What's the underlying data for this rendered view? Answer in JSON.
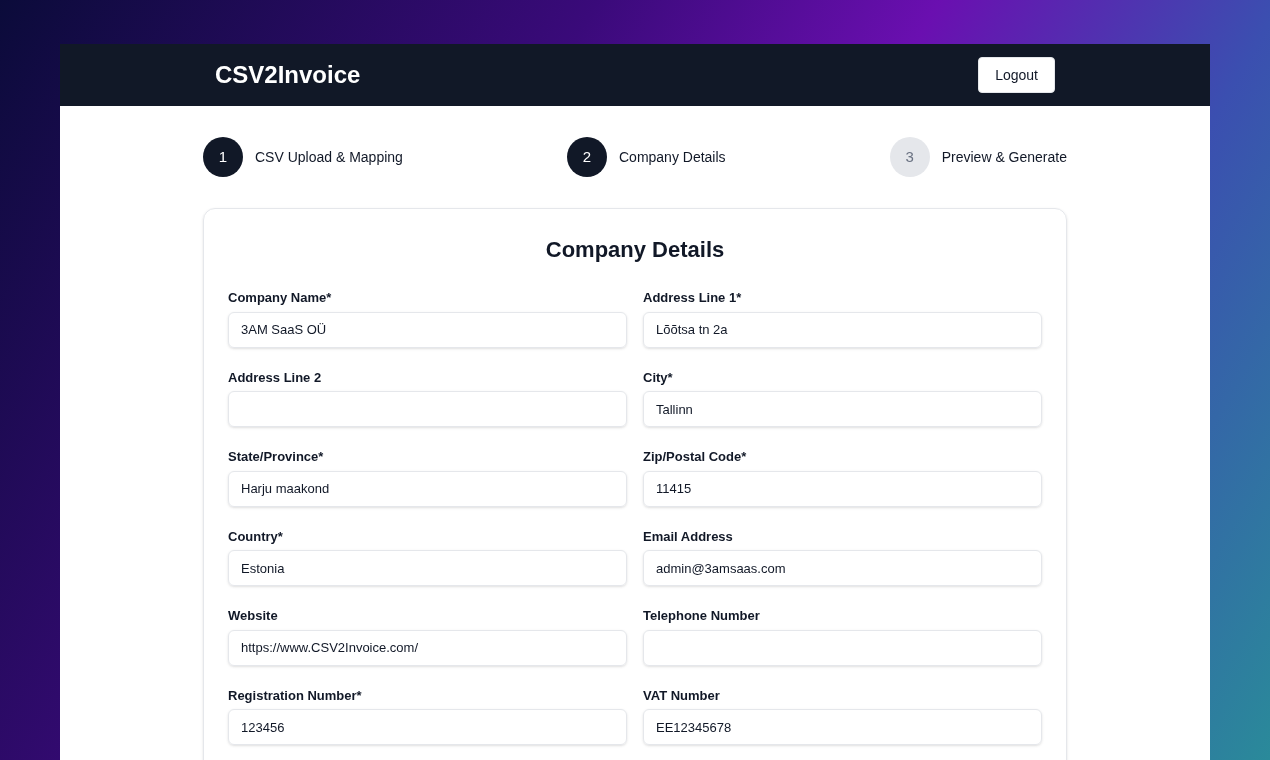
{
  "header": {
    "brand": "CSV2Invoice",
    "logout": "Logout"
  },
  "steps": [
    {
      "number": "1",
      "label": "CSV Upload & Mapping",
      "active": true
    },
    {
      "number": "2",
      "label": "Company Details",
      "active": true
    },
    {
      "number": "3",
      "label": "Preview & Generate",
      "active": false
    }
  ],
  "form": {
    "title": "Company Details",
    "fields": [
      {
        "label": "Company Name*",
        "value": "3AM SaaS OÜ"
      },
      {
        "label": "Address Line 1*",
        "value": "Lõõtsa tn 2a"
      },
      {
        "label": "Address Line 2"
      },
      {
        "label": "City*",
        "value": "Tallinn"
      },
      {
        "label": "State/Province*",
        "value": "Harju maakond"
      },
      {
        "label": "Zip/Postal Code*",
        "value": "11415"
      },
      {
        "label": "Country*",
        "value": "Estonia"
      },
      {
        "label": "Email Address",
        "value": "admin@3amsaas.com"
      },
      {
        "label": "Website",
        "value": "https://www.CSV2Invoice.com/"
      },
      {
        "label": "Telephone Number"
      },
      {
        "label": "Registration Number*",
        "value": "123456"
      },
      {
        "label": "VAT Number",
        "value": "EE12345678"
      }
    ]
  }
}
